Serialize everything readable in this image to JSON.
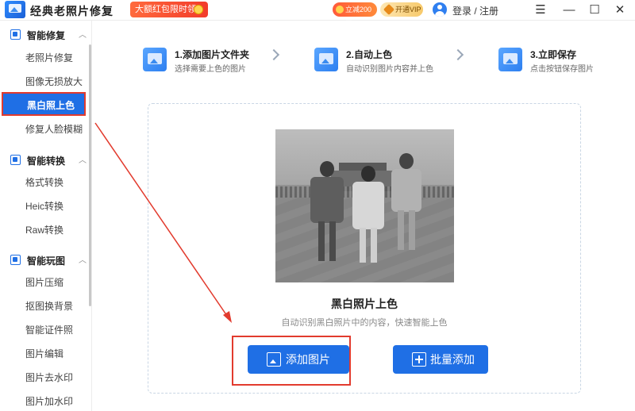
{
  "app": {
    "title": "经典老照片修复",
    "promo": "大额红包限时领",
    "save_badge": "立减200元",
    "vip_button": "开通VIP",
    "login": "登录 / 注册",
    "window_menu": "☰",
    "window_min": "—",
    "window_max": "☐",
    "window_close": "✕"
  },
  "sidebar": {
    "groups": [
      {
        "label": "智能修复",
        "caret": "︿",
        "items": [
          "老照片修复",
          "图像无损放大",
          "黑白照上色",
          "修复人脸模糊"
        ]
      },
      {
        "label": "智能转换",
        "caret": "︿",
        "items": [
          "格式转换",
          "Heic转换",
          "Raw转换"
        ]
      },
      {
        "label": "智能玩图",
        "caret": "︿",
        "items": [
          "图片压缩",
          "抠图换背景",
          "智能证件照",
          "图片编辑",
          "图片去水印",
          "图片加水印"
        ]
      }
    ],
    "active_item": "黑白照上色"
  },
  "steps": [
    {
      "title": "1.添加图片文件夹",
      "desc": "选择需要上色的图片"
    },
    {
      "title": "2.自动上色",
      "desc": "自动识别图片内容并上色"
    },
    {
      "title": "3.立即保存",
      "desc": "点击按钮保存图片"
    }
  ],
  "main": {
    "feature_title": "黑白照片上色",
    "feature_desc": "自动识别黑白照片中的内容，快速智能上色",
    "add_button": "添加图片",
    "batch_button": "批量添加"
  },
  "colors": {
    "accent": "#1f6fe5",
    "highlight": "#e23b2e"
  }
}
